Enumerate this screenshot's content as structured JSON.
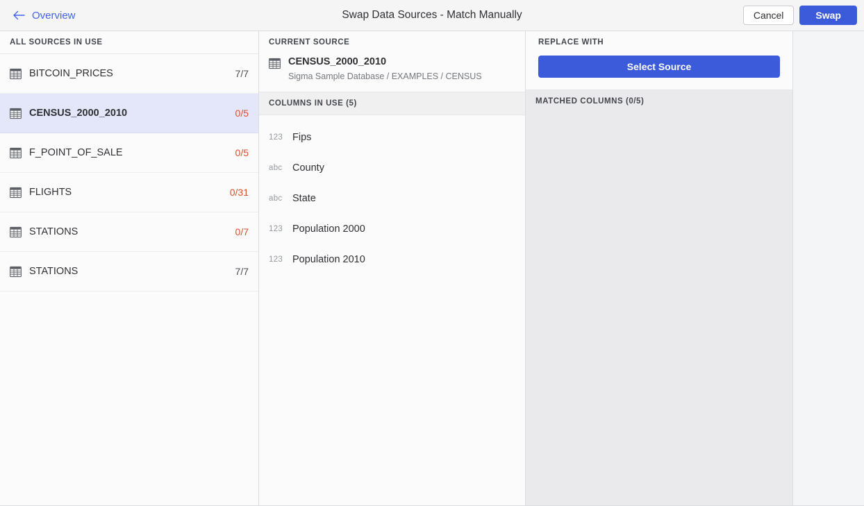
{
  "header": {
    "back_label": "Overview",
    "back_icon": "arrow-left-icon",
    "title": "Swap Data Sources - Match Manually",
    "cancel_label": "Cancel",
    "swap_label": "Swap",
    "accent_color": "#3b5bdb",
    "link_color": "#4263eb"
  },
  "sidebar": {
    "title": "ALL SOURCES IN USE",
    "items": [
      {
        "name": "BITCOIN_PRICES",
        "count": "7/7",
        "icon": "table-icon",
        "selected": false,
        "warn": false
      },
      {
        "name": "CENSUS_2000_2010",
        "count": "0/5",
        "icon": "table-icon",
        "selected": true,
        "warn": true
      },
      {
        "name": "F_POINT_OF_SALE",
        "count": "0/5",
        "icon": "table-icon",
        "selected": false,
        "warn": true
      },
      {
        "name": "FLIGHTS",
        "count": "0/31",
        "icon": "table-icon",
        "selected": false,
        "warn": true
      },
      {
        "name": "STATIONS",
        "count": "0/7",
        "icon": "table-icon",
        "selected": false,
        "warn": true
      },
      {
        "name": "STATIONS",
        "count": "7/7",
        "icon": "table-icon",
        "selected": false,
        "warn": false
      }
    ]
  },
  "current_source": {
    "title": "CURRENT SOURCE",
    "icon": "table-icon",
    "name": "CENSUS_2000_2010",
    "path": "Sigma Sample Database / EXAMPLES / CENSUS"
  },
  "columns_in_use": {
    "title": "COLUMNS IN USE (5)",
    "items": [
      {
        "type": "123",
        "name": "Fips"
      },
      {
        "type": "abc",
        "name": "County"
      },
      {
        "type": "abc",
        "name": "State"
      },
      {
        "type": "123",
        "name": "Population 2000"
      },
      {
        "type": "123",
        "name": "Population 2010"
      }
    ]
  },
  "replace_with": {
    "title": "REPLACE WITH",
    "select_source_label": "Select Source"
  },
  "matched_columns": {
    "title": "MATCHED COLUMNS (0/5)",
    "items": []
  },
  "colors": {
    "warn_text": "#d9512c",
    "selected_row_bg": "#e3e7f9",
    "panel_bg": "#fbfbfc",
    "page_bg": "#f4f5f6"
  }
}
